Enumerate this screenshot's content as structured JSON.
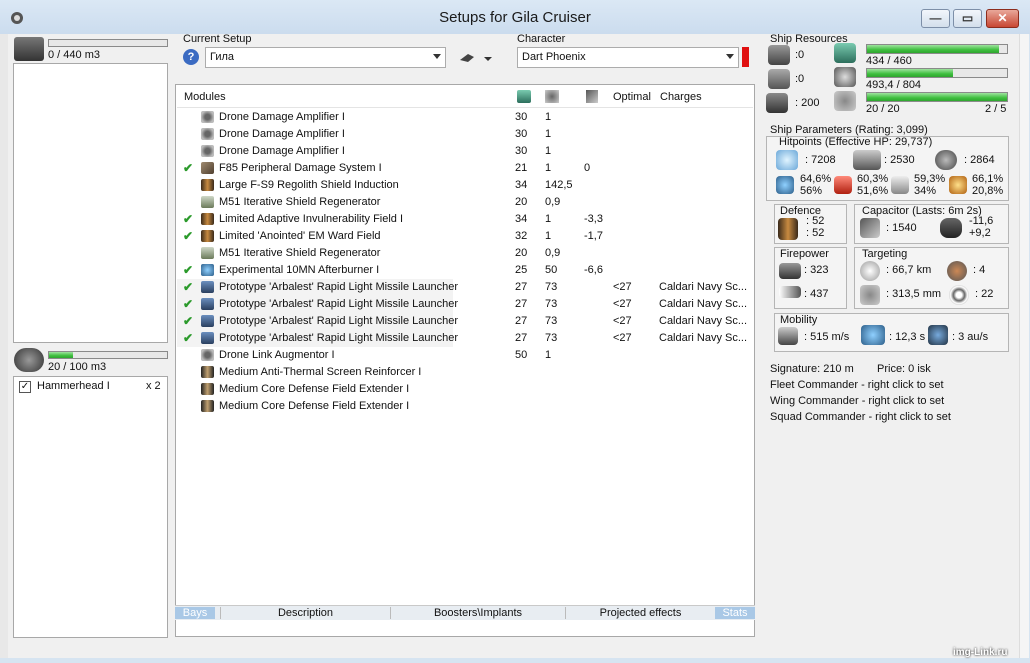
{
  "window": {
    "title": "Setups for Gila Cruiser",
    "min": "—",
    "max": "▭",
    "close": "✕"
  },
  "cargo": {
    "text": "0 / 440 m3",
    "fill": 0
  },
  "drones": {
    "text": "20 / 100 m3",
    "fill": 0.2,
    "items": [
      {
        "name": "Hammerhead I",
        "qty": "x 2",
        "checked": true
      }
    ]
  },
  "setup": {
    "label": "Current Setup",
    "value": "Гила"
  },
  "character": {
    "label": "Character",
    "value": "Dart Phoenix"
  },
  "modules": {
    "headers": [
      "Modules",
      "",
      "",
      "",
      "Optimal",
      "Charges"
    ],
    "rows": [
      {
        "check": "",
        "icon": "drone",
        "name": "Drone Damage Amplifier I",
        "cpu": "30",
        "pg": "1",
        "cap": "",
        "opt": "",
        "charge": ""
      },
      {
        "check": "",
        "icon": "drone",
        "name": "Drone Damage Amplifier I",
        "cpu": "30",
        "pg": "1",
        "cap": "",
        "opt": "",
        "charge": ""
      },
      {
        "check": "",
        "icon": "drone",
        "name": "Drone Damage Amplifier I",
        "cpu": "30",
        "pg": "1",
        "cap": "",
        "opt": "",
        "charge": ""
      },
      {
        "check": "✔",
        "icon": "eng",
        "name": "F85 Peripheral Damage System I",
        "cpu": "21",
        "pg": "1",
        "cap": "0",
        "opt": "",
        "charge": ""
      },
      {
        "check": "",
        "icon": "shd",
        "name": "Large F-S9 Regolith Shield Induction",
        "cpu": "34",
        "pg": "142,5",
        "cap": "",
        "opt": "",
        "charge": ""
      },
      {
        "check": "",
        "icon": "reg",
        "name": "M51 Iterative Shield Regenerator",
        "cpu": "20",
        "pg": "0,9",
        "cap": "",
        "opt": "",
        "charge": ""
      },
      {
        "check": "✔",
        "icon": "shd",
        "name": "Limited Adaptive Invulnerability Field I",
        "cpu": "34",
        "pg": "1",
        "cap": "-3,3",
        "opt": "",
        "charge": ""
      },
      {
        "check": "✔",
        "icon": "shd",
        "name": "Limited 'Anointed' EM Ward Field",
        "cpu": "32",
        "pg": "1",
        "cap": "-1,7",
        "opt": "",
        "charge": ""
      },
      {
        "check": "",
        "icon": "reg",
        "name": "M51 Iterative Shield Regenerator",
        "cpu": "20",
        "pg": "0,9",
        "cap": "",
        "opt": "",
        "charge": ""
      },
      {
        "check": "✔",
        "icon": "ab",
        "name": "Experimental 10MN Afterburner I",
        "cpu": "25",
        "pg": "50",
        "cap": "-6,6",
        "opt": "",
        "charge": ""
      },
      {
        "check": "✔",
        "icon": "ml",
        "name": "Prototype 'Arbalest' Rapid Light Missile Launcher",
        "cpu": "27",
        "pg": "73",
        "cap": "",
        "opt": "<27",
        "charge": "Caldari Navy Sc..."
      },
      {
        "check": "✔",
        "icon": "ml",
        "name": "Prototype 'Arbalest' Rapid Light Missile Launcher",
        "cpu": "27",
        "pg": "73",
        "cap": "",
        "opt": "<27",
        "charge": "Caldari Navy Sc..."
      },
      {
        "check": "✔",
        "icon": "ml",
        "name": "Prototype 'Arbalest' Rapid Light Missile Launcher",
        "cpu": "27",
        "pg": "73",
        "cap": "",
        "opt": "<27",
        "charge": "Caldari Navy Sc..."
      },
      {
        "check": "✔",
        "icon": "ml",
        "name": "Prototype 'Arbalest' Rapid Light Missile Launcher",
        "cpu": "27",
        "pg": "73",
        "cap": "",
        "opt": "<27",
        "charge": "Caldari Navy Sc..."
      },
      {
        "check": "",
        "icon": "drone",
        "name": "Drone Link Augmentor I",
        "cpu": "50",
        "pg": "1",
        "cap": "",
        "opt": "",
        "charge": ""
      },
      {
        "check": "",
        "icon": "arm",
        "name": "Medium Anti-Thermal Screen Reinforcer I",
        "cpu": "",
        "pg": "",
        "cap": "",
        "opt": "",
        "charge": ""
      },
      {
        "check": "",
        "icon": "arm",
        "name": "Medium Core Defense Field Extender I",
        "cpu": "",
        "pg": "",
        "cap": "",
        "opt": "",
        "charge": ""
      },
      {
        "check": "",
        "icon": "arm",
        "name": "Medium Core Defense Field Extender I",
        "cpu": "",
        "pg": "",
        "cap": "",
        "opt": "",
        "charge": ""
      }
    ]
  },
  "bottom_tabs": [
    "Bays",
    "Description",
    "Boosters\\Implants",
    "Projected effects",
    "Stats"
  ],
  "resources": {
    "title": "Ship Resources",
    "hardpoints": [
      ":0",
      ":0",
      ": 200"
    ],
    "cpu": {
      "text": "434 / 460",
      "fill": 0.943
    },
    "pg": {
      "text": "493,4 / 804",
      "fill": 0.614
    },
    "drone_bw": {
      "text": "20 / 20",
      "fill": 1.0
    },
    "drones_active": "2 / 5"
  },
  "params": {
    "title": "Ship Parameters (Rating: 3,099)",
    "hitpoints": "Hitpoints (Effective HP: 29,737)",
    "hp": [
      ": 7208",
      ": 2530",
      ": 2864"
    ],
    "resists": [
      [
        "64,6%",
        "56%"
      ],
      [
        "60,3%",
        "51,6%"
      ],
      [
        "59,3%",
        "34%"
      ],
      [
        "66,1%",
        "20,8%"
      ]
    ],
    "defence": {
      "title": "Defence",
      "a": ": 52",
      "b": ": 52"
    },
    "capacitor": {
      "title": "Capacitor (Lasts: 6m 2s)",
      "cap": ": 1540",
      "delta1": "-11,6",
      "delta2": "+9,2"
    },
    "firepower": {
      "title": "Firepower",
      "a": ": 323",
      "b": ": 437"
    },
    "targeting": {
      "title": "Targeting",
      "range": ": 66,7 km",
      "targets": ": 4",
      "scan": ": 313,5 mm",
      "sensor": ": 22"
    },
    "mobility": {
      "title": "Mobility",
      "speed": ": 515 m/s",
      "align": ": 12,3 s",
      "warp": ": 3 au/s"
    },
    "signature": "Signature: 210 m",
    "price": "Price: 0 isk",
    "fleet": "Fleet Commander - right click to set",
    "wing": "Wing Commander - right click to set",
    "squad": "Squad Commander - right click to set"
  },
  "watermark": "img-Link.ru"
}
